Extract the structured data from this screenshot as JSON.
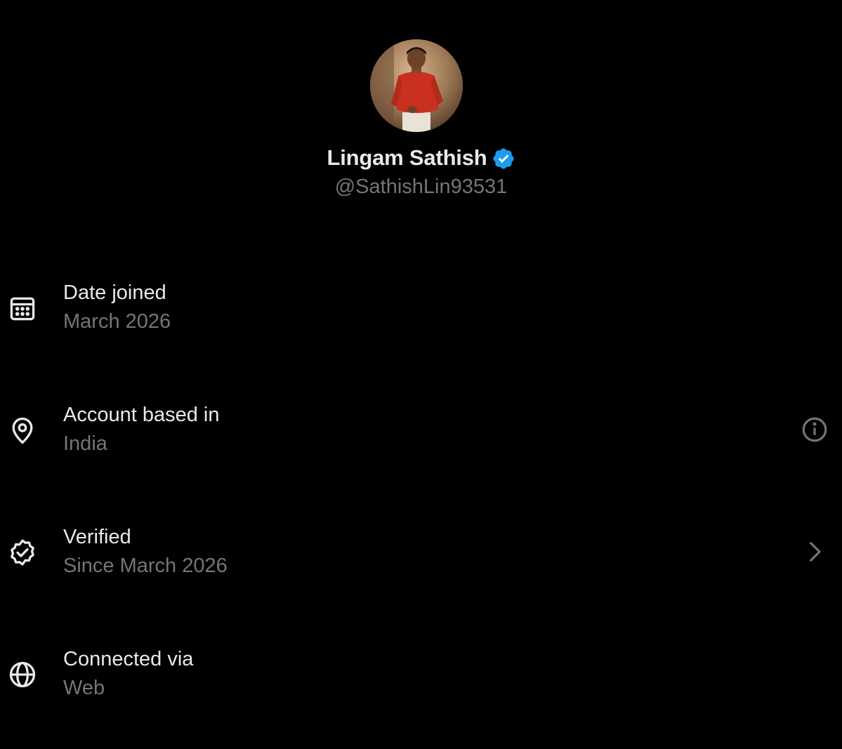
{
  "profile": {
    "display_name": "Lingam Sathish",
    "handle": "@SathishLin93531",
    "avatar": "avatar",
    "verified_badge": "verified-check-icon",
    "badge_color": "#1d9bf0"
  },
  "info_rows": [
    {
      "icon": "calendar-icon",
      "title": "Date joined",
      "value": "March 2026"
    },
    {
      "icon": "location-pin-icon",
      "title": "Account based in",
      "value": "India",
      "action_icon": "info-icon"
    },
    {
      "icon": "verified-badge-icon",
      "title": "Verified",
      "value": "Since March 2026",
      "action_icon": "chevron-right-icon"
    },
    {
      "icon": "globe-icon",
      "title": "Connected via",
      "value": "Web"
    }
  ],
  "colors": {
    "background": "#000000",
    "primary_text": "#e7e9ea",
    "secondary_text": "#71767b",
    "accent": "#1d9bf0"
  }
}
